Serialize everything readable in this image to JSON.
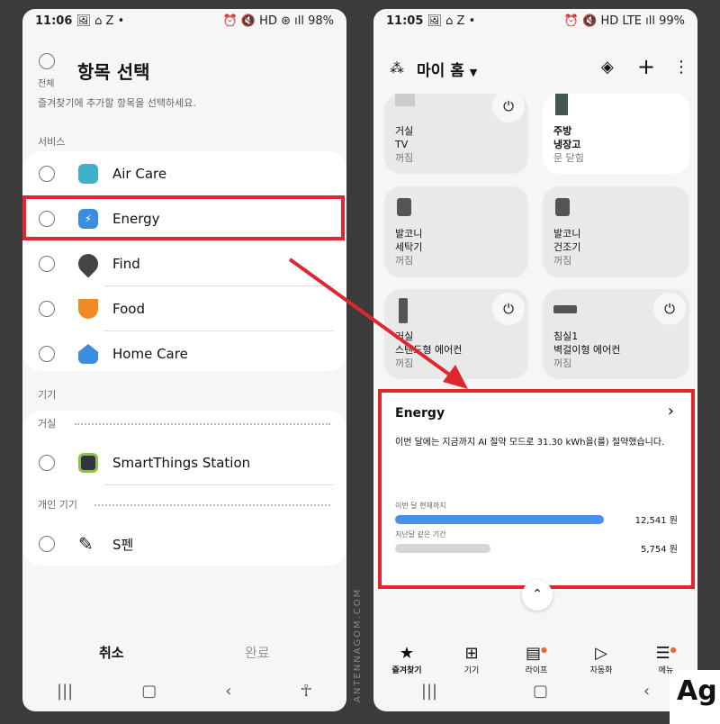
{
  "left": {
    "status": {
      "time": "11:06",
      "icons": "🖼 ⌂ Z •",
      "right": "⏰ 🔇 HD ⊛ ıll 98%"
    },
    "select_all_label": "전체",
    "title": "항목 선택",
    "subtitle": "즐겨찾기에 추가할 항목을 선택하세요.",
    "section_services": "서비스",
    "services": [
      {
        "label": "Air Care",
        "icon": "air-care-icon",
        "color": "#3fb0c9"
      },
      {
        "label": "Energy",
        "icon": "energy-icon",
        "color": "#3b8de0"
      },
      {
        "label": "Find",
        "icon": "find-icon",
        "color": "#444444"
      },
      {
        "label": "Food",
        "icon": "food-icon",
        "color": "#f08a24"
      },
      {
        "label": "Home Care",
        "icon": "home-care-icon",
        "color": "#3b8de0"
      }
    ],
    "section_devices": "기기",
    "room_living": "거실",
    "device_station": "SmartThings Station",
    "room_personal": "개인 기기",
    "device_spen": "S펜",
    "cancel": "취소",
    "done": "완료"
  },
  "right": {
    "status": {
      "time": "11:05",
      "icons": "🖼 ⌂ Z •",
      "right": "⏰ 🔇 HD LTE ıll 99%"
    },
    "home_title": "마이 홈",
    "tiles": [
      {
        "room": "거실",
        "name": "TV",
        "state": "꺼짐",
        "power": true
      },
      {
        "room": "주방",
        "name": "냉장고",
        "state": "문 닫힘",
        "power": false
      },
      {
        "room": "발코니",
        "name": "세탁기",
        "state": "꺼짐",
        "power": false
      },
      {
        "room": "발코니",
        "name": "건조기",
        "state": "꺼짐",
        "power": false
      },
      {
        "room": "거실",
        "name": "스탠드형 에어컨",
        "state": "꺼짐",
        "power": true
      },
      {
        "room": "침실1",
        "name": "벽걸이형 에어컨",
        "state": "꺼짐",
        "power": true
      }
    ],
    "energy": {
      "title": "Energy",
      "message": "이번 달에는 지금까지 AI 절약 모드로 31.30 kWh을(를) 절약했습니다.",
      "this_month_label": "이번 달 현재까지",
      "this_month_value": "12,541 원",
      "last_month_label": "지난달 같은 기간",
      "last_month_value": "5,754 원",
      "bar_color": "#4a90e8",
      "this_month_amount": 12541,
      "last_month_amount": 5754
    },
    "nav": [
      "즐겨찾기",
      "기기",
      "라이프",
      "자동화",
      "메뉴"
    ]
  },
  "watermark": "ANTENNAGOM.COM",
  "logo": "Ag"
}
